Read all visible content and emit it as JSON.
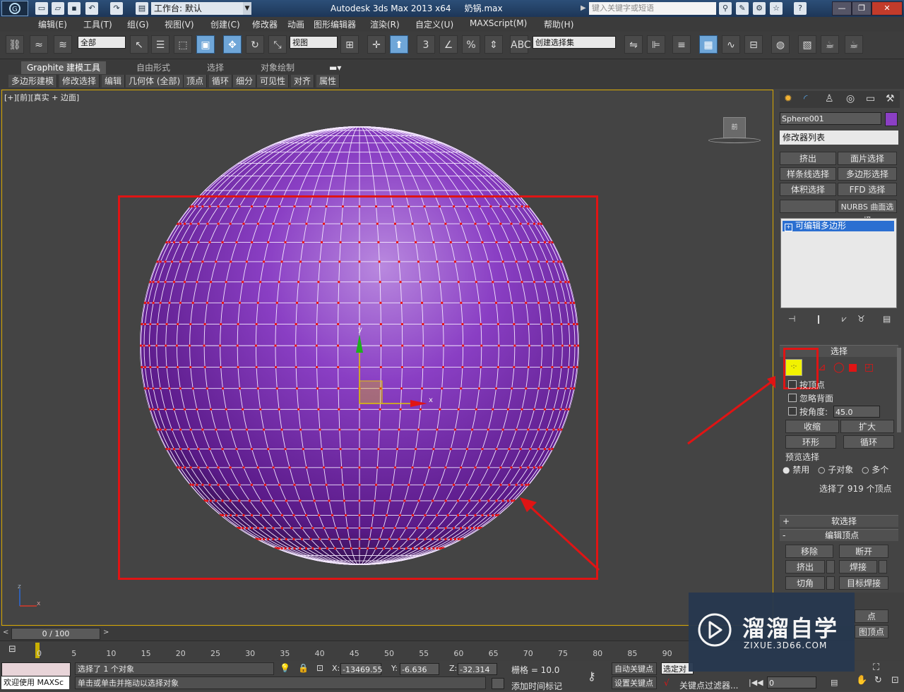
{
  "titlebar": {
    "workspace_label": "工作台: 默认",
    "app_title": "Autodesk 3ds Max  2013 x64",
    "file_name": "奶锅.max",
    "search_placeholder": "键入关键字或短语",
    "minimize": "—",
    "restore": "❐",
    "close": "✕",
    "app_icon": "3ds-max-logo-icon"
  },
  "menu": [
    "编辑(E)",
    "工具(T)",
    "组(G)",
    "视图(V)",
    "创建(C)",
    "修改器",
    "动画",
    "图形编辑器",
    "渲染(R)",
    "自定义(U)",
    "MAXScript(M)",
    "帮助(H)"
  ],
  "toolbar": {
    "selection_filter": "全部",
    "ref_coord": "视图",
    "named_selection": "创建选择集",
    "snap_3": "3",
    "angle_snap": "%"
  },
  "ribbon": {
    "tabs": [
      "Graphite 建模工具",
      "自由形式",
      "选择",
      "对象绘制"
    ],
    "subtabs": [
      "多边形建模",
      "修改选择",
      "编辑",
      "几何体 (全部)",
      "顶点",
      "循环",
      "细分",
      "可见性",
      "对齐",
      "属性"
    ]
  },
  "viewport": {
    "label": "[+][前][真实 + 边面]",
    "viewcube_label": "前",
    "axis_x": "x",
    "axis_y": "y",
    "mini_axis_x": "x",
    "mini_axis_z": "z",
    "sphere_color": "#8a3fc4"
  },
  "command_panel": {
    "object_name": "Sphere001",
    "object_color": "#8b3fc4",
    "modifier_list": "修改器列表",
    "modifier_buttons": [
      "挤出",
      "面片选择",
      "样条线选择",
      "多边形选择",
      "体积选择",
      "FFD 选择",
      "",
      "NURBS 曲面选择"
    ],
    "stack_item": "可编辑多边形",
    "selection_rollout": "选择",
    "by_vertex": "按顶点",
    "ignore_backfacing": "忽略背面",
    "by_angle": "按角度:",
    "angle_value": "45.0",
    "shrink": "收缩",
    "grow": "扩大",
    "ring": "环形",
    "loop": "循环",
    "preview_selection": "预览选择",
    "preview_options": [
      "禁用",
      "子对象",
      "多个"
    ],
    "selection_info": "选择了 919 个顶点",
    "soft_selection": "软选择",
    "edit_vertices": "编辑顶点",
    "edit_buttons": [
      "移除",
      "断开",
      "挤出",
      "焊接",
      "切角",
      "目标焊接"
    ],
    "partial_labels": [
      "点",
      "图顶点"
    ]
  },
  "timeline": {
    "frame_display": "0 / 100",
    "ticks": [
      "0",
      "5",
      "10",
      "15",
      "20",
      "25",
      "30",
      "35",
      "40",
      "45",
      "50",
      "55",
      "60",
      "65",
      "70",
      "75",
      "80",
      "85",
      "90"
    ]
  },
  "status": {
    "welcome": "欢迎使用 MAXSc",
    "selected": "选择了 1 个对象",
    "prompt": "单击或单击并拖动以选择对象",
    "x_label": "X:",
    "x_value": "-13469.55",
    "y_label": "Y:",
    "y_value": "-6.636",
    "z_label": "Z:",
    "z_value": "-32.314",
    "grid": "栅格 = 10.0",
    "auto_key": "自动关键点",
    "selected_obj": "选定对",
    "set_key": "设置关键点",
    "key_filters": "关键点过滤器...",
    "add_time_tag": "添加时间标记",
    "frame_field": "0"
  },
  "watermark": {
    "brand": "溜溜自学",
    "url": "ZIXUE.3D66.COM"
  }
}
